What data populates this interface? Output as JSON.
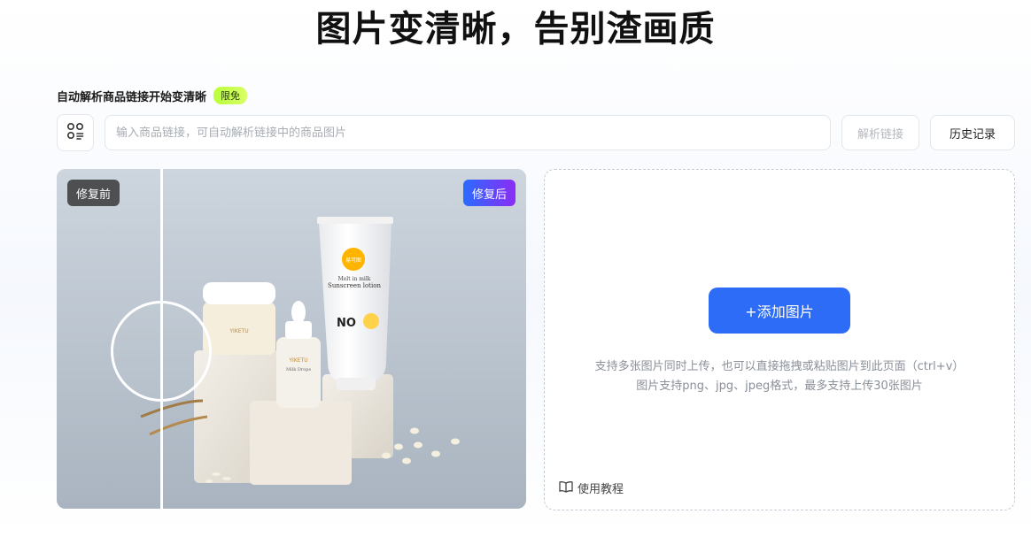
{
  "header": {
    "title": "图片变清晰，告别渣画质"
  },
  "link_section": {
    "label": "自动解析商品链接开始变清晰",
    "badge": "限免",
    "input_placeholder": "输入商品链接，可自动解析链接中的商品图片",
    "input_value": "",
    "parse_button": "解析链接",
    "history_button": "历史记录"
  },
  "compare": {
    "before_label": "修复前",
    "after_label": "修复后",
    "split_position": 0.22,
    "product_labels": {
      "tube_brand": "易可图",
      "tube_line1": "Melt in milk",
      "tube_line2": "Sunscreen lotion",
      "tube_no": "NO",
      "jar_brand": "YIKETU",
      "dropper_brand": "YIKETU",
      "dropper_line": "Milk Drops"
    }
  },
  "upload": {
    "add_button": "+添加图片",
    "hint_line1": "支持多张图片同时上传，也可以直接拖拽或粘贴图片到此页面（ctrl+v）",
    "hint_line2": "图片支持png、jpg、jpeg格式，最多支持上传30张图片",
    "tutorial_label": "使用教程"
  },
  "colors": {
    "primary": "#2c6cf6",
    "badge": "#c3ff4d",
    "after_gradient_start": "#2a6cff",
    "after_gradient_end": "#8b2cf5"
  },
  "icons": {
    "scan": "app-grid-icon",
    "tutorial": "book-icon"
  }
}
